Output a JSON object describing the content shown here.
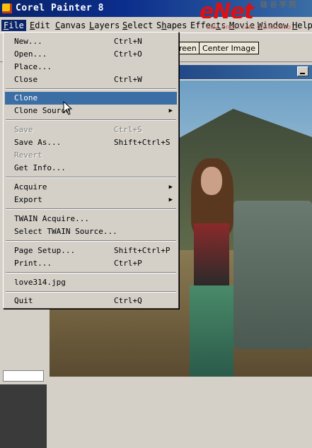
{
  "window": {
    "title": "Corel Painter 8"
  },
  "watermark": {
    "brand": "eNet",
    "cn": "硅 谷 学 院",
    "url": "www.enet.com.cn/eschool"
  },
  "menubar": {
    "items": [
      {
        "label": "File",
        "u": "F",
        "rest": "ile"
      },
      {
        "label": "Edit",
        "u": "E",
        "rest": "dit"
      },
      {
        "label": "Canvas",
        "u": "C",
        "rest": "anvas"
      },
      {
        "label": "Layers",
        "u": "L",
        "rest": "ayers"
      },
      {
        "label": "Select",
        "u": "S",
        "rest": "elect"
      },
      {
        "label": "Shapes",
        "pre": "S",
        "u": "h",
        "rest": "apes"
      },
      {
        "label": "Effects",
        "pre": "Effec",
        "u": "t",
        "rest": "s"
      },
      {
        "label": "Movie",
        "u": "M",
        "rest": "ovie"
      },
      {
        "label": "Window",
        "u": "W",
        "rest": "indow"
      },
      {
        "label": "Help",
        "u": "H",
        "rest": "elp"
      }
    ]
  },
  "toolbar": {
    "screen_button_label": "reen",
    "center_button_label": "Center Image"
  },
  "file_menu": {
    "items": [
      {
        "label": "New...",
        "shortcut": "Ctrl+N"
      },
      {
        "label": "Open...",
        "shortcut": "Ctrl+O"
      },
      {
        "label": "Place...",
        "shortcut": ""
      },
      {
        "label": "Close",
        "shortcut": "Ctrl+W"
      },
      {
        "label": "Clone",
        "shortcut": ""
      },
      {
        "label": "Clone Source",
        "shortcut": ""
      },
      {
        "label": "Save",
        "shortcut": "Ctrl+S"
      },
      {
        "label": "Save As...",
        "shortcut": "Shift+Ctrl+S"
      },
      {
        "label": "Revert",
        "shortcut": ""
      },
      {
        "label": "Get Info...",
        "shortcut": ""
      },
      {
        "label": "Acquire",
        "shortcut": ""
      },
      {
        "label": "Export",
        "shortcut": ""
      },
      {
        "label": "TWAIN Acquire...",
        "shortcut": ""
      },
      {
        "label": "Select TWAIN Source...",
        "shortcut": ""
      },
      {
        "label": "Page Setup...",
        "shortcut": "Shift+Ctrl+P"
      },
      {
        "label": "Print...",
        "shortcut": "Ctrl+P"
      },
      {
        "label": "love314.jpg",
        "shortcut": ""
      },
      {
        "label": "Quit",
        "shortcut": "Ctrl+Q"
      }
    ],
    "highlighted": "Clone",
    "disabled": [
      "Save",
      "Revert"
    ],
    "submenus": [
      "Clone Source",
      "Acquire",
      "Export"
    ]
  },
  "icons": {
    "app": "painter-app-icon",
    "cursor": "mouse-pointer-icon",
    "submenu": "triangle-right-icon",
    "minimize": "minimize-icon"
  },
  "colors": {
    "title_bar": "#0a246a",
    "highlight": "#3a6ea5",
    "menu_bg": "#d4d0c8",
    "watermark": "#d11111"
  }
}
